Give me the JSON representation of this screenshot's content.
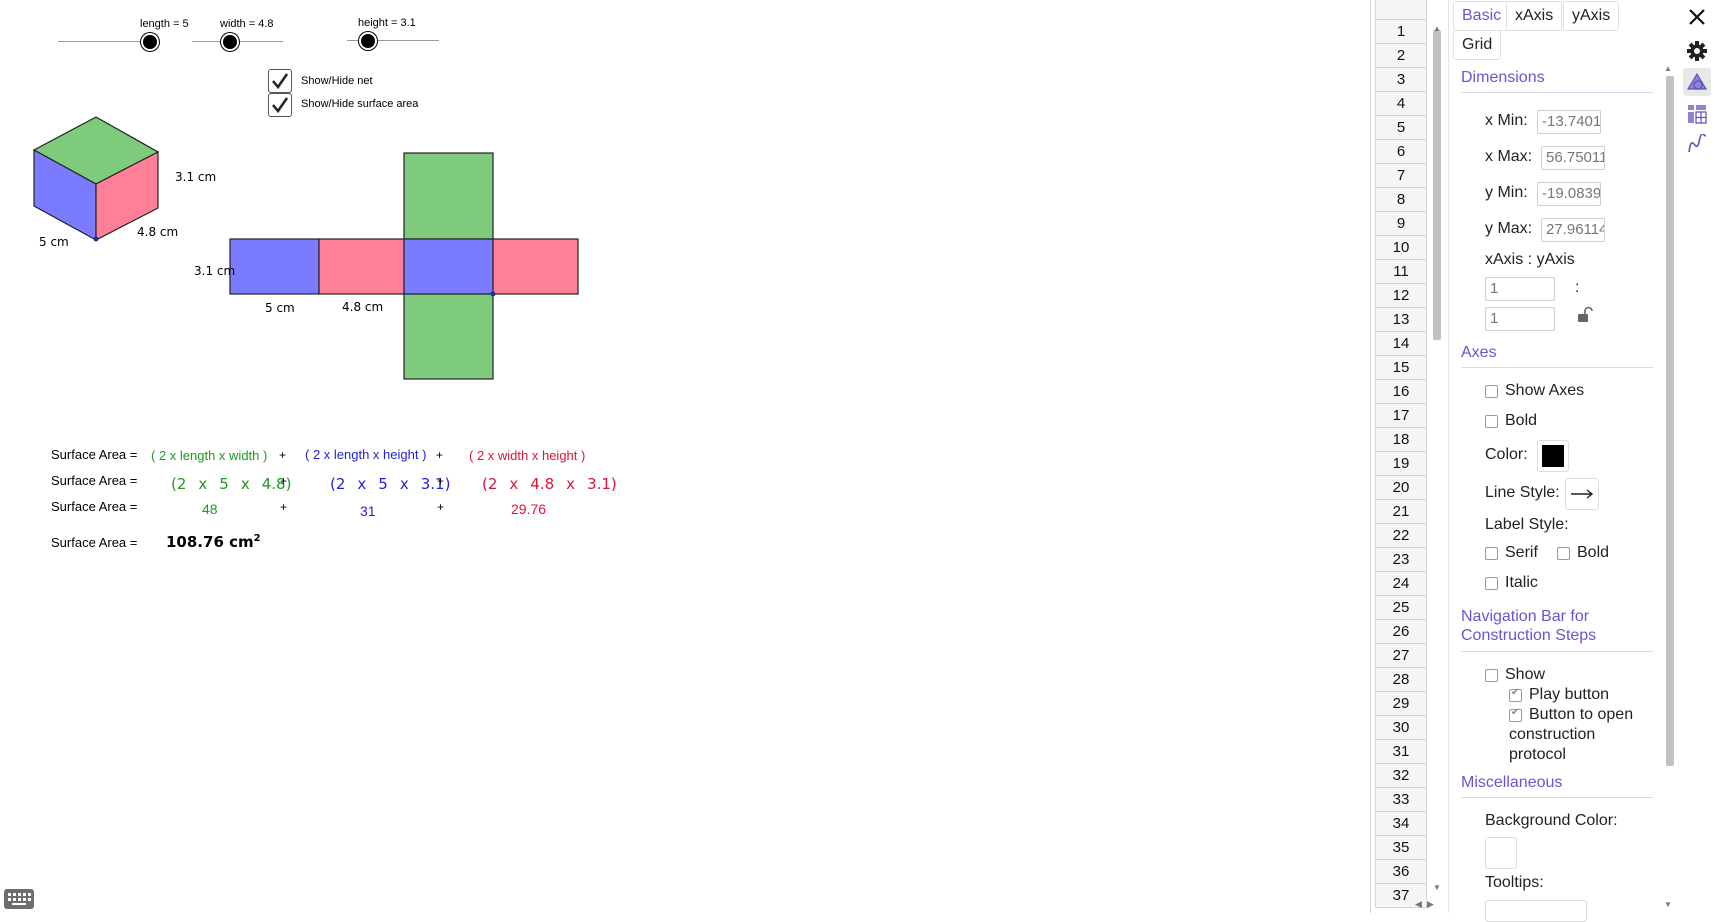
{
  "sliders": [
    {
      "label": "length = 5",
      "value": 5
    },
    {
      "label": "width = 4.8",
      "value": 4.8
    },
    {
      "label": "height = 3.1",
      "value": 3.1
    }
  ],
  "checkboxes": [
    {
      "label": "Show/Hide net",
      "checked": true
    },
    {
      "label": "Show/Hide surface area",
      "checked": true
    }
  ],
  "cube_labels": {
    "height": "3.1 cm",
    "width": "4.8 cm",
    "length": "5 cm"
  },
  "net_labels": {
    "height": "3.1 cm",
    "length": "5 cm",
    "width": "4.8 cm"
  },
  "colors": {
    "top_bottom": "#7ecb7e",
    "front_back": "#7b7bff",
    "sides": "#ff7f96",
    "accent": "#6557d2"
  },
  "surface_area": {
    "label": "Surface Area =",
    "plus": "+",
    "row1": [
      "( 2 x length x width )",
      "( 2 x length x height )",
      "( 2 x width x height )"
    ],
    "row2": [
      [
        "(2",
        "x",
        "5",
        "x",
        "4.8)"
      ],
      [
        "(2",
        "x",
        "5",
        "x",
        "3.1)"
      ],
      [
        "(2",
        "x",
        "4.8",
        "x",
        "3.1)"
      ]
    ],
    "row3": [
      "48",
      "31",
      "29.76"
    ],
    "total": "108.76 cm",
    "total_sup": "2"
  },
  "spreadsheet": {
    "rows": [
      "1",
      "2",
      "3",
      "4",
      "5",
      "6",
      "7",
      "8",
      "9",
      "10",
      "11",
      "12",
      "13",
      "14",
      "15",
      "16",
      "17",
      "18",
      "19",
      "20",
      "21",
      "22",
      "23",
      "24",
      "25",
      "26",
      "27",
      "28",
      "29",
      "30",
      "31",
      "32",
      "33",
      "34",
      "35",
      "36",
      "37"
    ]
  },
  "properties": {
    "tabs": [
      "Basic",
      "xAxis",
      "yAxis",
      "Grid"
    ],
    "dimensions": {
      "title": "Dimensions",
      "xmin_label": "x Min:",
      "xmin": "-13.7401",
      "xmax_label": "x Max:",
      "xmax": "56.75011",
      "ymin_label": "y Min:",
      "ymin": "-19.0839",
      "ymax_label": "y Max:",
      "ymax": "27.96114",
      "ratio_label": "xAxis : yAxis",
      "ratio_x": "1",
      "ratio_y": "1",
      "colon": ":"
    },
    "axes": {
      "title": "Axes",
      "show_axes": "Show Axes",
      "bold": "Bold",
      "color_label": "Color:",
      "color": "#000000",
      "line_style_label": "Line Style:",
      "label_style_label": "Label Style:",
      "serif": "Serif",
      "bold2": "Bold",
      "italic": "Italic"
    },
    "navigation": {
      "title_line1": "Navigation Bar for",
      "title_line2": "Construction Steps",
      "show": "Show",
      "play_button": "Play button",
      "protocol_l1": "Button to open",
      "protocol_l2": "construction",
      "protocol_l3": "protocol"
    },
    "misc": {
      "title": "Miscellaneous",
      "bg_label": "Background Color:",
      "tooltips_label": "Tooltips:"
    }
  },
  "icons": [
    "close-icon",
    "gear-icon",
    "graphics-icon",
    "spreadsheet-icon",
    "function-icon",
    "keyboard-icon"
  ]
}
